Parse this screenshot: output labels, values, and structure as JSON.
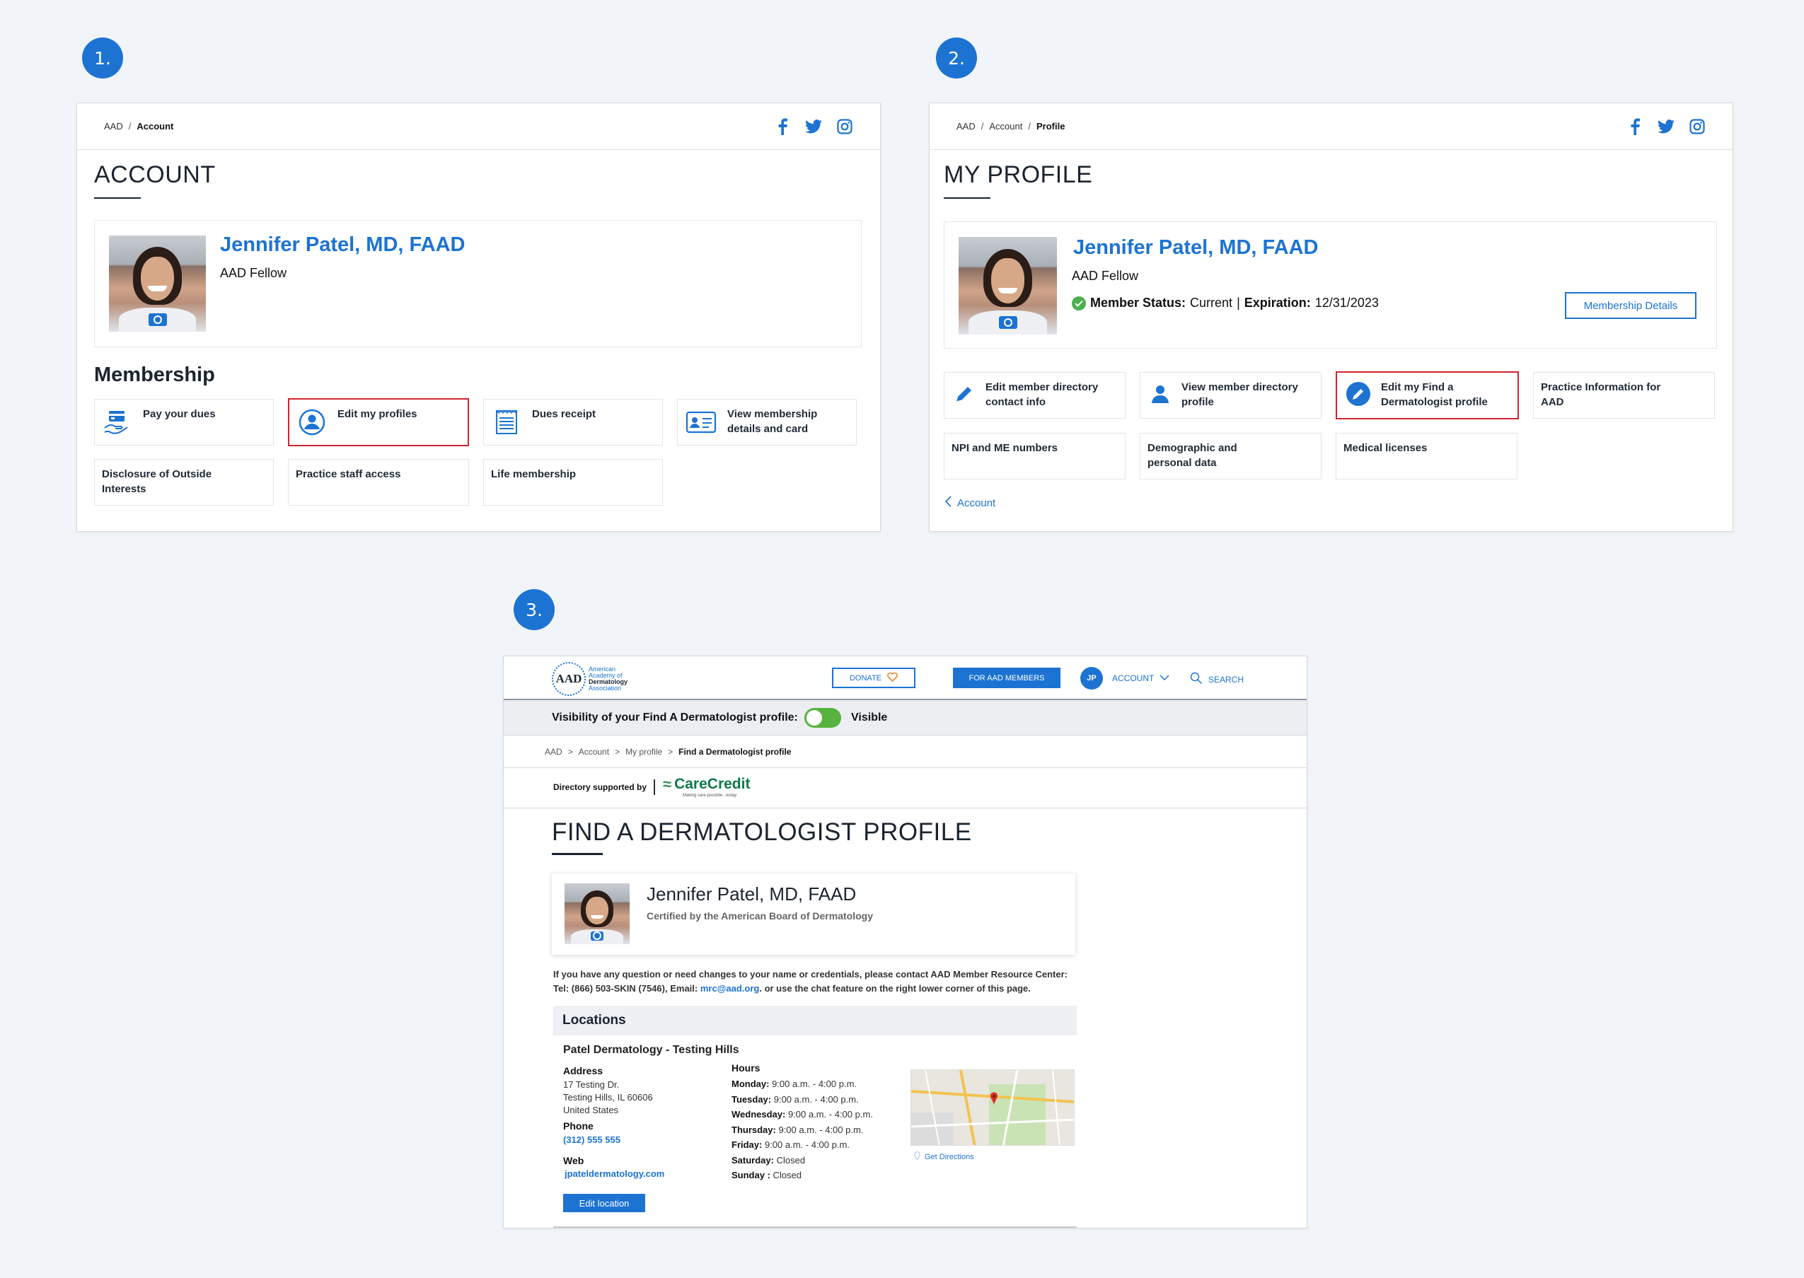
{
  "steps": [
    "1.",
    "2.",
    "3."
  ],
  "panel1": {
    "breadcrumb": [
      "AAD",
      "Account"
    ],
    "title": "ACCOUNT",
    "member_name": "Jennifer Patel, MD, FAAD",
    "member_title": "AAD Fellow",
    "section_title": "Membership",
    "tiles": [
      {
        "label": "Pay your dues",
        "icon": "hand-card-icon"
      },
      {
        "label": "Edit my profiles",
        "icon": "user-circle-icon",
        "highlighted": true
      },
      {
        "label": "Dues receipt",
        "icon": "receipt-icon"
      },
      {
        "label": "View membership details and card",
        "icon": "id-card-icon"
      },
      {
        "label": "Disclosure of Outside Interests"
      },
      {
        "label": "Practice staff access"
      },
      {
        "label": "Life membership"
      }
    ]
  },
  "panel2": {
    "breadcrumb": [
      "AAD",
      "Account",
      "Profile"
    ],
    "title": "MY PROFILE",
    "member_name": "Jennifer Patel, MD, FAAD",
    "member_title": "AAD Fellow",
    "status_label": "Member Status:",
    "status_value": "Current",
    "separator": "|",
    "expiration_label": "Expiration:",
    "expiration_value": "12/31/2023",
    "membership_details_button": "Membership Details",
    "tiles": [
      {
        "label": "Edit member directory contact info",
        "icon": "pencil-icon"
      },
      {
        "label": "View member directory profile",
        "icon": "person-icon"
      },
      {
        "label": "Edit my Find a Dermatologist profile",
        "icon": "pencil-circle-icon",
        "highlighted": true
      },
      {
        "label": "Practice Information for AAD"
      },
      {
        "label": "NPI and ME numbers"
      },
      {
        "label": "Demographic and personal data"
      },
      {
        "label": "Medical licenses"
      }
    ],
    "back_link": "Account"
  },
  "panel3": {
    "logo_text": [
      "American",
      "Academy of",
      "Dermatology",
      "Association"
    ],
    "logo_mark": "AAD",
    "donate": "DONATE",
    "for_members": "FOR AAD MEMBERS",
    "avatar_initials": "JP",
    "account": "ACCOUNT",
    "search": "SEARCH",
    "visibility_label": "Visibility of your Find A Dermatologist profile:",
    "visibility_state": "Visible",
    "breadcrumb": [
      "AAD",
      "Account",
      "My profile",
      "Find a Dermatologist profile"
    ],
    "supported_by": "Directory supported by",
    "sponsor": "CareCredit",
    "sponsor_tagline": "Making care possible...today.",
    "title": "FIND A DERMATOLOGIST PROFILE",
    "profile_name": "Jennifer Patel, MD, FAAD",
    "certification": "Certified by the American Board of Dermatology",
    "contact_line1": "If you have any question or need changes to your name or credentials, please contact AAD Member Resource Center:",
    "contact_line2_pre": "Tel: (866) 503-SKIN (7546), Email:",
    "contact_email": "mrc@aad.org",
    "contact_line2_post": ". or use the chat feature on the right lower corner of this page.",
    "locations_heading": "Locations",
    "location": {
      "name": "Patel Dermatology - Testing Hills",
      "address_label": "Address",
      "address_lines": [
        "17 Testing Dr.",
        "Testing Hills, IL 60606",
        "United States"
      ],
      "phone_label": "Phone",
      "phone": "(312) 555 555",
      "web_label": "Web",
      "web": "jpateldermatology.com",
      "hours_label": "Hours",
      "hours": [
        {
          "day": "Monday:",
          "time": "9:00 a.m. - 4:00 p.m."
        },
        {
          "day": "Tuesday:",
          "time": "9:00 a.m. - 4:00 p.m."
        },
        {
          "day": "Wednesday:",
          "time": "9:00 a.m. - 4:00 p.m."
        },
        {
          "day": "Thursday:",
          "time": "9:00 a.m. - 4:00 p.m."
        },
        {
          "day": "Friday:",
          "time": "9:00 a.m. - 4:00 p.m."
        },
        {
          "day": "Saturday:",
          "time": "Closed"
        },
        {
          "day": "Sunday :",
          "time": "Closed"
        }
      ],
      "get_directions": "Get Directions",
      "edit_button": "Edit location"
    }
  },
  "colors": {
    "accent": "#1c73d2",
    "highlight": "#d1242f",
    "toggle_on": "#57b33e",
    "background": "#f1f4f8"
  }
}
